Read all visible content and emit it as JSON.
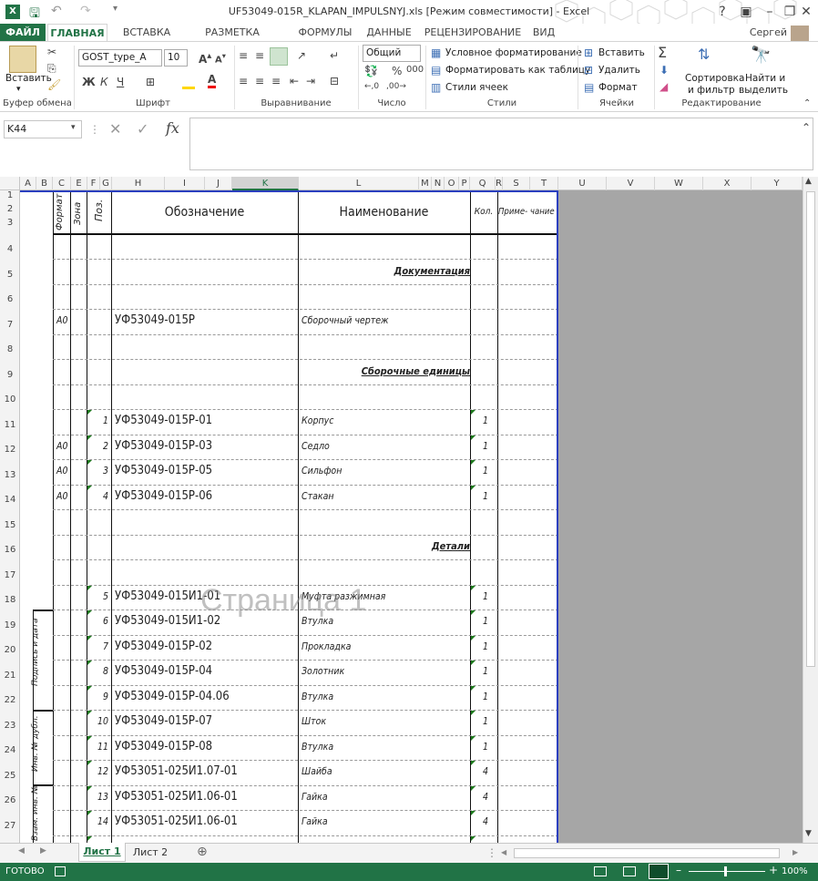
{
  "window": {
    "title": "UF53049-015R_KLAPAN_IMPULSNYJ.xls  [Режим совместимости] - Excel",
    "help": "?",
    "minimize": "–",
    "restore": "❐",
    "close": "✕"
  },
  "tabs": [
    "ФАЙЛ",
    "ГЛАВНАЯ",
    "ВСТАВКА",
    "РАЗМЕТКА СТРАНИЦЫ",
    "ФОРМУЛЫ",
    "ДАННЫЕ",
    "РЕЦЕНЗИРОВАНИЕ",
    "ВИД"
  ],
  "user": "Сергей Дубровский",
  "ribbon": {
    "paste": "Вставить",
    "clipboard": "Буфер обмена",
    "font_name": "GOST_type_A",
    "font_size": "10",
    "font_group": "Шрифт",
    "bold": "Ж",
    "italic": "К",
    "underline": "Ч",
    "align_group": "Выравнивание",
    "number_format": "Общий",
    "number_group": "Число",
    "cond_format": "Условное форматирование",
    "format_table": "Форматировать как таблицу",
    "cell_styles": "Стили ячеек",
    "styles_group": "Стили",
    "insert": "Вставить",
    "delete": "Удалить",
    "format": "Формат",
    "cells_group": "Ячейки",
    "sort_filter_1": "Сортировка",
    "sort_filter_2": "и фильтр",
    "find_1": "Найти и",
    "find_2": "выделить",
    "editing_group": "Редактирование"
  },
  "formula": {
    "name_box": "K44",
    "fx": "fx",
    "value": ""
  },
  "columns": [
    "A",
    "B",
    "C",
    "E",
    "F",
    "G",
    "H",
    "I",
    "J",
    "K",
    "L",
    "M",
    "N",
    "O",
    "P",
    "Q",
    "R",
    "S",
    "T",
    "U",
    "V",
    "W",
    "X",
    "Y"
  ],
  "rows": [
    "1",
    "2",
    "3",
    "4",
    "5",
    "6",
    "7",
    "8",
    "9",
    "10",
    "11",
    "12",
    "13",
    "14",
    "15",
    "16",
    "17",
    "18",
    "19",
    "20",
    "21",
    "22",
    "23",
    "24",
    "25",
    "26",
    "27"
  ],
  "spec": {
    "headers": {
      "format": "Формат",
      "zone": "Зона",
      "pos": "Поз.",
      "designation": "Обозначение",
      "name": "Наименование",
      "qty": "Кол.",
      "note": "Приме- чание"
    },
    "side_labels": [
      "Подпись и дата",
      "Инв. № дубл.",
      "Взам. инв. №"
    ],
    "sections": {
      "docs": "Документация",
      "assemblies": "Сборочные единицы",
      "parts": "Детали"
    },
    "items": [
      {
        "fmt": "А0",
        "pos": "",
        "des": "УФ53049-015Р",
        "name": "Сборочный чертеж",
        "qty": ""
      },
      {
        "fmt": "",
        "pos": "1",
        "des": "УФ53049-015Р-01",
        "name": "Корпус",
        "qty": "1"
      },
      {
        "fmt": "А0",
        "pos": "2",
        "des": "УФ53049-015Р-03",
        "name": "Седло",
        "qty": "1"
      },
      {
        "fmt": "А0",
        "pos": "3",
        "des": "УФ53049-015Р-05",
        "name": "Сильфон",
        "qty": "1"
      },
      {
        "fmt": "А0",
        "pos": "4",
        "des": "УФ53049-015Р-06",
        "name": "Стакан",
        "qty": "1"
      },
      {
        "fmt": "",
        "pos": "5",
        "des": "УФ53049-015И1-01",
        "name": "Муфта разжимная",
        "qty": "1"
      },
      {
        "fmt": "",
        "pos": "6",
        "des": "УФ53049-015И1-02",
        "name": "Втулка",
        "qty": "1"
      },
      {
        "fmt": "",
        "pos": "7",
        "des": "УФ53049-015Р-02",
        "name": "Прокладка",
        "qty": "1"
      },
      {
        "fmt": "",
        "pos": "8",
        "des": "УФ53049-015Р-04",
        "name": "Золотник",
        "qty": "1"
      },
      {
        "fmt": "",
        "pos": "9",
        "des": "УФ53049-015Р-04.06",
        "name": "Втулка",
        "qty": "1"
      },
      {
        "fmt": "",
        "pos": "10",
        "des": "УФ53049-015Р-07",
        "name": "Шток",
        "qty": "1"
      },
      {
        "fmt": "",
        "pos": "11",
        "des": "УФ53049-015Р-08",
        "name": "Втулка",
        "qty": "1"
      },
      {
        "fmt": "",
        "pos": "12",
        "des": "УФ53051-025И1.07-01",
        "name": "Шайба",
        "qty": "4"
      },
      {
        "fmt": "",
        "pos": "13",
        "des": "УФ53051-025И1.06-01",
        "name": "Гайка",
        "qty": "4"
      },
      {
        "fmt": "",
        "pos": "14",
        "des": "УФ53051-025И1.06-01",
        "name": "Гайка",
        "qty": "4"
      }
    ]
  },
  "watermark": "Страница 1",
  "sheets": {
    "active": "Лист 1",
    "other": "Лист 2",
    "add": "⊕"
  },
  "status": {
    "ready": "ГОТОВО",
    "zoom": "100%"
  }
}
